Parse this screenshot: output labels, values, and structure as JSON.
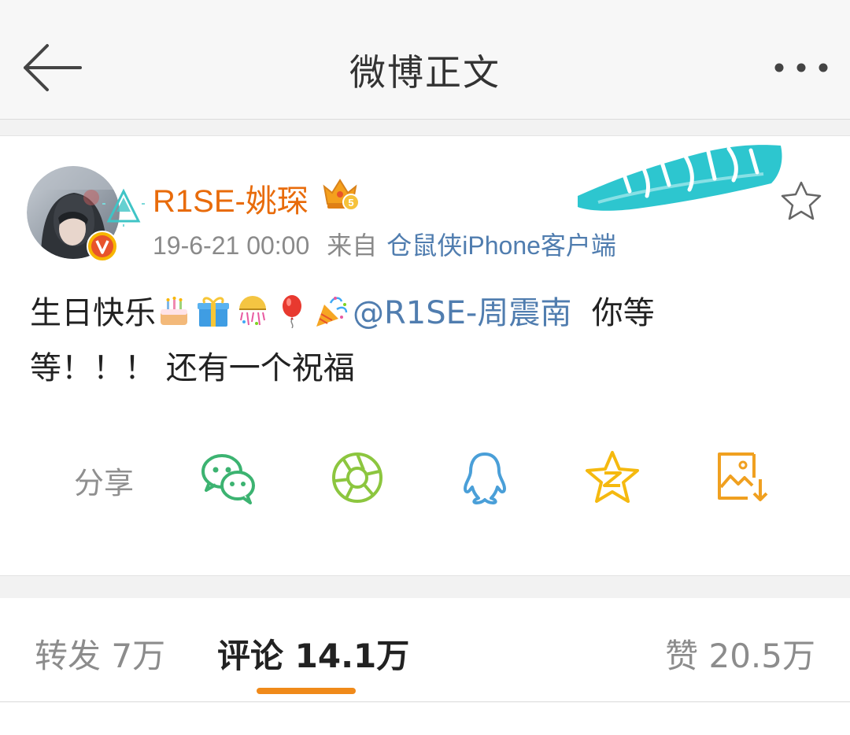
{
  "navbar": {
    "title": "微博正文",
    "back_icon": "arrow-left-icon",
    "more_icon": "more-dots-icon"
  },
  "post": {
    "username": "R1SE-姚琛",
    "timestamp": "19-6-21 00:00",
    "from_label": "来自",
    "client": "仓鼠侠iPhone客户端",
    "text_before": "生日快乐",
    "emojis": [
      "birthday-cake-emoji",
      "gift-emoji",
      "confetti-ball-emoji",
      "balloon-emoji",
      "party-popper-emoji"
    ],
    "mention": "@R1SE-周震南",
    "text_after": "  你等",
    "text_line2": "等！！！ 还有一个祝福",
    "share_label": "分享",
    "share_targets": [
      "wechat-icon",
      "moments-icon",
      "qq-icon",
      "qzone-icon",
      "save-image-icon"
    ],
    "colors": {
      "username": "#e86b0a",
      "link": "#507daf",
      "accent": "#f08a1a"
    }
  },
  "tabs": {
    "repost": "转发 7万",
    "comment": "评论 14.1万",
    "like": "赞 20.5万",
    "active": "comment"
  }
}
